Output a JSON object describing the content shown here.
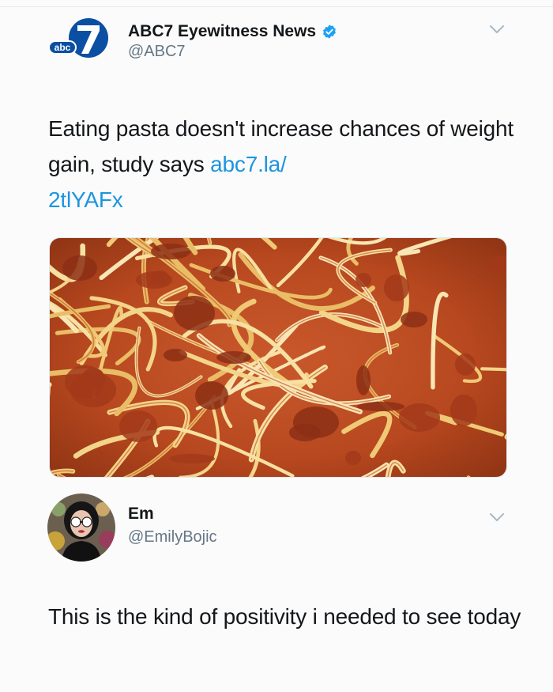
{
  "tweets": [
    {
      "author": {
        "name": "ABC7 Eyewitness News",
        "handle": "@ABC7",
        "verified": true,
        "logo_text": "abc",
        "logo_number": "7"
      },
      "text": "Eating pasta doesn't increase chances of weight gain, study says ",
      "link": "abc7.la/\n2tlYAFx",
      "media": {
        "subject": "spaghetti with meat sauce photo"
      }
    },
    {
      "author": {
        "name": "Em",
        "handle": "@EmilyBojic",
        "verified": false
      },
      "text": "This is the kind of positivity i needed to see today"
    }
  ],
  "colors": {
    "link": "#1b95e0",
    "handle": "#657786",
    "text": "#14171a",
    "verified": "#1da1f2",
    "abc_blue": "#0b4fa3"
  },
  "icons": [
    "abc7-logo",
    "verified-badge-icon",
    "chevron-down-icon",
    "avatar"
  ]
}
